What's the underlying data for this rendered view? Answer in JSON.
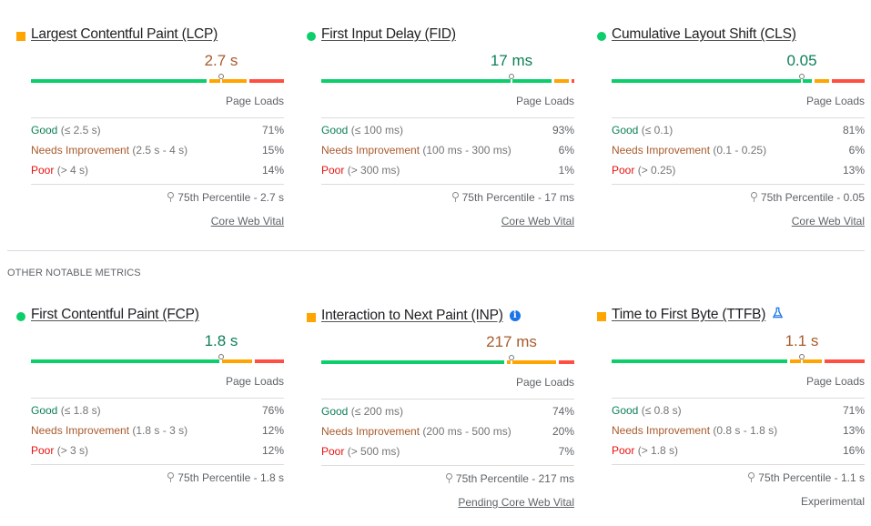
{
  "colors": {
    "good": "#0cce6b",
    "needs_improvement": "#ffa400",
    "poor": "#ff4e42",
    "good_text": "#0d7f55",
    "ni_text": "#a85a2c",
    "poor_text": "#e8110f",
    "info_icon": "#1a73e8"
  },
  "core_metrics": [
    {
      "title": "Largest Contentful Paint (LCP)",
      "status": "needs-improvement",
      "value": "2.7 s",
      "page_loads_label": "Page Loads",
      "distribution": [
        {
          "label": "Good",
          "range": "(≤ 2.5 s)",
          "percent": "71%",
          "fraction": 0.71
        },
        {
          "label": "Needs Improvement",
          "range": "(2.5 s - 4 s)",
          "percent": "15%",
          "fraction": 0.15
        },
        {
          "label": "Poor",
          "range": "(> 4 s)",
          "percent": "14%",
          "fraction": 0.14
        }
      ],
      "p75_position": 0.75,
      "p75_label": "75th Percentile - 2.7 s",
      "footer": "Core Web Vital",
      "footer_is_link": true
    },
    {
      "title": "First Input Delay (FID)",
      "status": "good",
      "value": "17 ms",
      "page_loads_label": "Page Loads",
      "distribution": [
        {
          "label": "Good",
          "range": "(≤ 100 ms)",
          "percent": "93%",
          "fraction": 0.93
        },
        {
          "label": "Needs Improvement",
          "range": "(100 ms - 300 ms)",
          "percent": "6%",
          "fraction": 0.06
        },
        {
          "label": "Poor",
          "range": "(> 300 ms)",
          "percent": "1%",
          "fraction": 0.01
        }
      ],
      "p75_position": 0.75,
      "p75_label": "75th Percentile - 17 ms",
      "footer": "Core Web Vital",
      "footer_is_link": true
    },
    {
      "title": "Cumulative Layout Shift (CLS)",
      "status": "good",
      "value": "0.05",
      "page_loads_label": "Page Loads",
      "distribution": [
        {
          "label": "Good",
          "range": "(≤ 0.1)",
          "percent": "81%",
          "fraction": 0.81
        },
        {
          "label": "Needs Improvement",
          "range": "(0.1 - 0.25)",
          "percent": "6%",
          "fraction": 0.06
        },
        {
          "label": "Poor",
          "range": "(> 0.25)",
          "percent": "13%",
          "fraction": 0.13
        }
      ],
      "p75_position": 0.75,
      "p75_label": "75th Percentile - 0.05",
      "footer": "Core Web Vital",
      "footer_is_link": true
    }
  ],
  "section_heading": "OTHER NOTABLE METRICS",
  "other_metrics": [
    {
      "title": "First Contentful Paint (FCP)",
      "status": "good",
      "value": "1.8 s",
      "title_icon": null,
      "page_loads_label": "Page Loads",
      "distribution": [
        {
          "label": "Good",
          "range": "(≤ 1.8 s)",
          "percent": "76%",
          "fraction": 0.76
        },
        {
          "label": "Needs Improvement",
          "range": "(1.8 s - 3 s)",
          "percent": "12%",
          "fraction": 0.12
        },
        {
          "label": "Poor",
          "range": "(> 3 s)",
          "percent": "12%",
          "fraction": 0.12
        }
      ],
      "p75_position": 0.75,
      "p75_label": "75th Percentile - 1.8 s",
      "footer": "",
      "footer_is_link": false
    },
    {
      "title": "Interaction to Next Paint (INP)",
      "status": "needs-improvement",
      "value": "217 ms",
      "title_icon": "info-icon",
      "page_loads_label": "Page Loads",
      "distribution": [
        {
          "label": "Good",
          "range": "(≤ 200 ms)",
          "percent": "74%",
          "fraction": 0.74
        },
        {
          "label": "Needs Improvement",
          "range": "(200 ms - 500 ms)",
          "percent": "20%",
          "fraction": 0.2
        },
        {
          "label": "Poor",
          "range": "(> 500 ms)",
          "percent": "7%",
          "fraction": 0.07
        }
      ],
      "p75_position": 0.75,
      "p75_label": "75th Percentile - 217 ms",
      "footer": "Pending Core Web Vital",
      "footer_is_link": true
    },
    {
      "title": "Time to First Byte (TTFB)",
      "status": "needs-improvement",
      "value": "1.1 s",
      "title_icon": "flask-icon",
      "page_loads_label": "Page Loads",
      "distribution": [
        {
          "label": "Good",
          "range": "(≤ 0.8 s)",
          "percent": "71%",
          "fraction": 0.71
        },
        {
          "label": "Needs Improvement",
          "range": "(0.8 s - 1.8 s)",
          "percent": "13%",
          "fraction": 0.13
        },
        {
          "label": "Poor",
          "range": "(> 1.8 s)",
          "percent": "16%",
          "fraction": 0.16
        }
      ],
      "p75_position": 0.75,
      "p75_label": "75th Percentile - 1.1 s",
      "footer": "Experimental",
      "footer_is_link": false
    }
  ]
}
